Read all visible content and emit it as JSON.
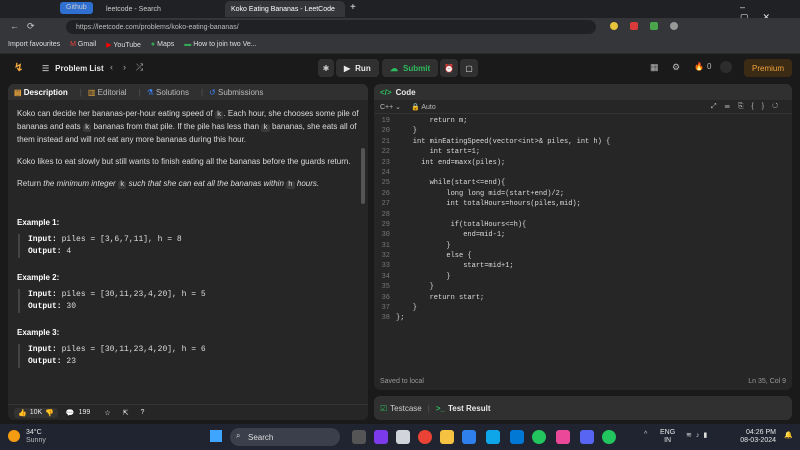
{
  "browser": {
    "tabs": [
      {
        "label": "Github",
        "active": false
      },
      {
        "label": "leetcode - Search",
        "active": false
      },
      {
        "label": "Koko Eating Bananas - LeetCode",
        "active": true
      }
    ],
    "url": "https://leetcode.com/problems/koko-eating-bananas/",
    "favorites": [
      "Import favourites",
      "Gmail",
      "YouTube",
      "Maps",
      "How to join two Ve..."
    ]
  },
  "nav": {
    "problem_list": "Problem List",
    "run": "Run",
    "submit": "Submit",
    "streak_count": "0",
    "premium": "Premium"
  },
  "left": {
    "tabs": [
      "Description",
      "Editorial",
      "Solutions",
      "Submissions"
    ],
    "desc": {
      "p1a": "Koko can decide her bananas-per-hour eating speed of ",
      "p1k": "k",
      "p1b": ". Each hour, she chooses some pile of bananas and eats ",
      "p1k2": "k",
      "p1c": " bananas from that pile. If the pile has less than ",
      "p1k3": "k",
      "p1d": " bananas, she eats all of them instead and will not eat any more bananas during this hour.",
      "p2": "Koko likes to eat slowly but still wants to finish eating all the bananas before the guards return.",
      "p3a": "Return ",
      "p3b": "the minimum integer ",
      "p3k": "k",
      "p3c": " such that she can eat all the bananas within ",
      "p3h": "h",
      "p3d": " hours."
    },
    "examples": [
      {
        "title": "Example 1:",
        "input_label": "Input:",
        "input": "piles = [3,6,7,11], h = 8",
        "output_label": "Output:",
        "output": "4"
      },
      {
        "title": "Example 2:",
        "input_label": "Input:",
        "input": "piles = [30,11,23,4,20], h = 5",
        "output_label": "Output:",
        "output": "30"
      },
      {
        "title": "Example 3:",
        "input_label": "Input:",
        "input": "piles = [30,11,23,4,20], h = 6",
        "output_label": "Output:",
        "output": "23"
      }
    ],
    "footer": {
      "likes": "10K",
      "comments": "199"
    }
  },
  "code": {
    "title": "Code",
    "language": "C++",
    "mode": "Auto",
    "lines": [
      {
        "n": "19",
        "t": "        return m;"
      },
      {
        "n": "20",
        "t": "    }"
      },
      {
        "n": "21",
        "t": "    int minEatingSpeed(vector<int>& piles, int h) {"
      },
      {
        "n": "22",
        "t": "        int start=1;"
      },
      {
        "n": "23",
        "t": "      int end=maxx(piles);"
      },
      {
        "n": "24",
        "t": ""
      },
      {
        "n": "25",
        "t": "        while(start<=end){"
      },
      {
        "n": "26",
        "t": "            long long mid=(start+end)/2;"
      },
      {
        "n": "27",
        "t": "            int totalHours=hours(piles,mid);"
      },
      {
        "n": "28",
        "t": ""
      },
      {
        "n": "29",
        "t": "             if(totalHours<=h){"
      },
      {
        "n": "30",
        "t": "                end=mid-1;"
      },
      {
        "n": "31",
        "t": "            }"
      },
      {
        "n": "32",
        "t": "            else {"
      },
      {
        "n": "33",
        "t": "                start=mid+1;"
      },
      {
        "n": "34",
        "t": "            }"
      },
      {
        "n": "35",
        "t": "        }"
      },
      {
        "n": "36",
        "t": "        return start;"
      },
      {
        "n": "37",
        "t": "    }"
      },
      {
        "n": "38",
        "t": "};"
      }
    ],
    "saved": "Saved to local",
    "cursor": "Ln 35, Col 9"
  },
  "test": {
    "testcase": "Testcase",
    "result": "Test Result"
  },
  "taskbar": {
    "temp": "34°C",
    "weather": "Sunny",
    "search": "Search",
    "lang1": "ENG",
    "lang2": "IN",
    "time": "04:26 PM",
    "date": "08-03-2024"
  }
}
